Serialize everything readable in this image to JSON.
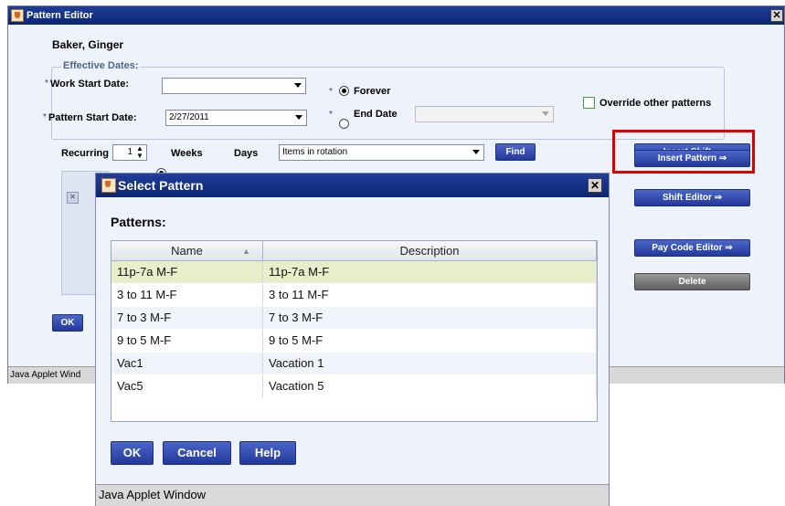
{
  "editor": {
    "title": "Pattern Editor",
    "employee_name": "Baker, Ginger",
    "effective_dates_label": "Effective Dates:",
    "required_mark": "*",
    "work_start_label": "Work Start Date:",
    "work_start_value": "",
    "pattern_start_label": "Pattern Start Date:",
    "pattern_start_value": "2/27/2011",
    "forever_label": "Forever",
    "end_date_label": "End Date",
    "end_date_value": "",
    "selected_end_option": "Forever",
    "override_label": "Override other patterns",
    "override_checked": false,
    "recurring_label": "Recurring",
    "recurring_value": "1",
    "weeks_label": "Weeks",
    "days_label": "Days",
    "selected_period": "Weeks",
    "rotation_value": "Items in rotation",
    "find_label": "Find",
    "buttons": {
      "insert_shift": "Insert Shift ⇒",
      "insert_pattern": "Insert Pattern ⇒",
      "shift_editor": "Shift Editor ⇒",
      "pay_code_editor": "Pay Code Editor ⇒",
      "delete": "Delete",
      "ok": "OK"
    },
    "status_text": "Java Applet Wind",
    "highlight_color": "#e00000"
  },
  "dialog": {
    "title": "Select Pattern",
    "patterns_label": "Patterns:",
    "columns": [
      "Name",
      "Description"
    ],
    "rows": [
      {
        "name": "11p-7a M-F",
        "description": "11p-7a M-F",
        "selected": true
      },
      {
        "name": "3 to 11 M-F",
        "description": "3 to 11 M-F"
      },
      {
        "name": "7 to 3 M-F",
        "description": "7 to 3 M-F"
      },
      {
        "name": "9 to 5 M-F",
        "description": "9 to 5 M-F"
      },
      {
        "name": "Vac1",
        "description": "Vacation 1"
      },
      {
        "name": "Vac5",
        "description": "Vacation 5"
      }
    ],
    "ok_label": "OK",
    "cancel_label": "Cancel",
    "help_label": "Help",
    "status_text": "Java Applet Window",
    "selected_row_color": "#e6efc9",
    "alt_row_color": "#f0f3fa"
  }
}
